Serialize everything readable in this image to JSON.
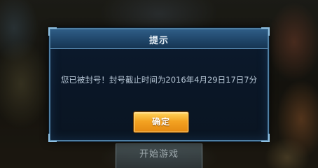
{
  "background": {
    "start_game_label": "开始游戏"
  },
  "dialog": {
    "title": "提示",
    "message": "您已被封号！封号截止时间为2016年4月29日17日7分",
    "confirm_label": "确定"
  },
  "colors": {
    "dialog_border": "#4f7fa3",
    "dialog_bg": "#0c1b2e",
    "header_bg": "#2f5d86",
    "confirm_button": "#f3a322"
  }
}
